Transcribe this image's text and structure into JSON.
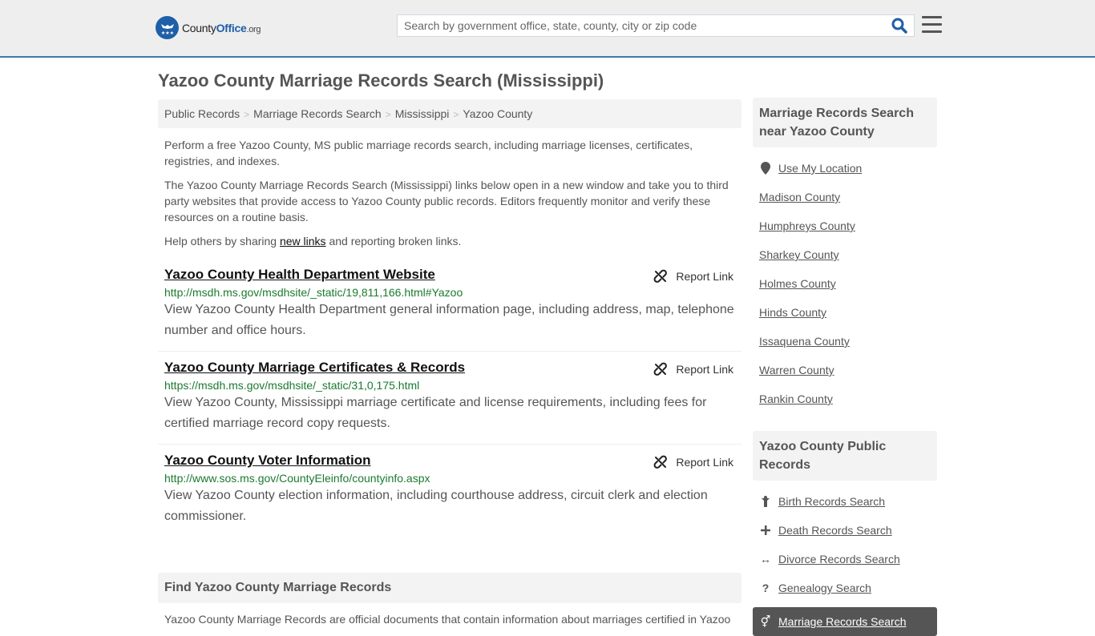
{
  "header": {
    "logo": {
      "county": "County",
      "office": "Office",
      "org": ".org"
    },
    "search_placeholder": "Search by government office, state, county, city or zip code",
    "search_value": ""
  },
  "page": {
    "title": "Yazoo County Marriage Records Search (Mississippi)"
  },
  "breadcrumb": [
    "Public Records",
    "Marriage Records Search",
    "Mississippi",
    "Yazoo County"
  ],
  "intro": {
    "p1": "Perform a free Yazoo County, MS public marriage records search, including marriage licenses, certificates, registries, and indexes.",
    "p2": "The Yazoo County Marriage Records Search (Mississippi) links below open in a new window and take you to third party websites that provide access to Yazoo County public records. Editors frequently monitor and verify these resources on a routine basis.",
    "p3_before": "Help others by sharing ",
    "p3_link": "new links",
    "p3_after": " and reporting broken links."
  },
  "links": [
    {
      "title": "Yazoo County Health Department Website",
      "url": "http://msdh.ms.gov/msdhsite/_static/19,811,166.html#Yazoo",
      "desc": "View Yazoo County Health Department general information page, including address, map, telephone number and office hours.",
      "report": "Report Link"
    },
    {
      "title": "Yazoo County Marriage Certificates & Records",
      "url": "https://msdh.ms.gov/msdhsite/_static/31,0,175.html",
      "desc": "View Yazoo County, Mississippi marriage certificate and license requirements, including fees for certified marriage record copy requests.",
      "report": "Report Link"
    },
    {
      "title": "Yazoo County Voter Information",
      "url": "http://www.sos.ms.gov/CountyEleinfo/countyinfo.aspx",
      "desc": "View Yazoo County election information, including courthouse address, circuit clerk and election commissioner.",
      "report": "Report Link"
    }
  ],
  "find_section": {
    "title": "Find Yazoo County Marriage Records",
    "body": "Yazoo County Marriage Records are official documents that contain information about marriages certified in Yazoo"
  },
  "sidebar": {
    "nearby": {
      "title": "Marriage Records Search near Yazoo County",
      "use_location": "Use My Location",
      "items": [
        "Madison County",
        "Humphreys County",
        "Sharkey County",
        "Holmes County",
        "Hinds County",
        "Issaquena County",
        "Warren County",
        "Rankin County"
      ]
    },
    "public_records": {
      "title": "Yazoo County Public Records",
      "items": [
        {
          "label": "Birth Records Search",
          "icon": "child-icon"
        },
        {
          "label": "Death Records Search",
          "icon": "plus-icon"
        },
        {
          "label": "Divorce Records Search",
          "icon": "arrows-horizontal-icon"
        },
        {
          "label": "Genealogy Search",
          "icon": "question-icon"
        }
      ],
      "active": {
        "label": "Marriage Records Search",
        "icon": "venus-mars-icon"
      }
    }
  }
}
